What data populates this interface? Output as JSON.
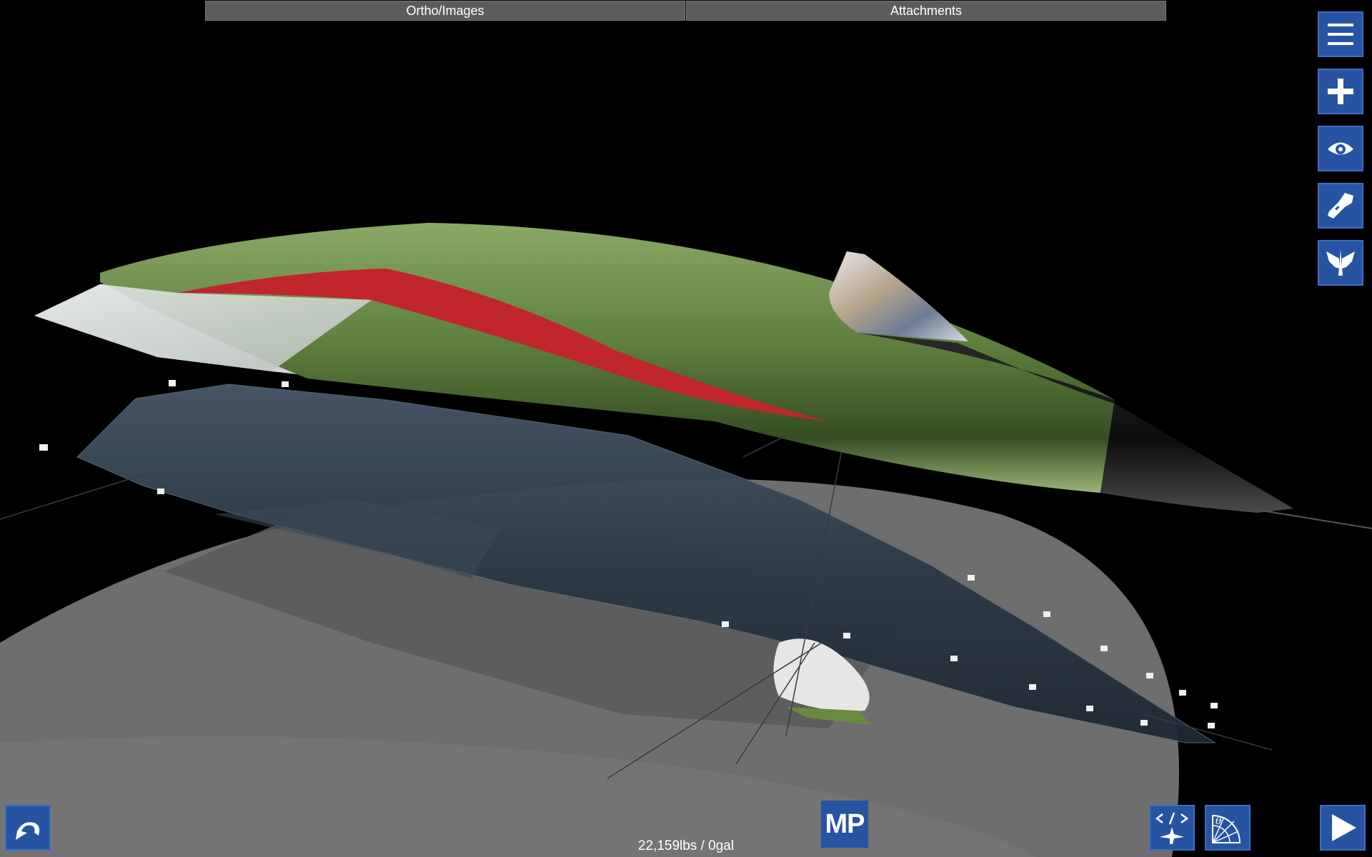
{
  "top_tabs": {
    "ortho_images": "Ortho/Images",
    "attachments": "Attachments"
  },
  "side_toolbar": {
    "icons": [
      "menu-icon",
      "plus-icon",
      "eye-icon",
      "paint-brush-icon",
      "wings-icon"
    ]
  },
  "bottom_bar": {
    "mp_label": "MP",
    "mass_readout": "22,159lbs / 0gal",
    "icons": [
      "undo-icon",
      "code-airplane-icon",
      "angle-gauge-icon",
      "play-icon"
    ]
  },
  "colors": {
    "button_blue": "#2753a3",
    "tab_gray": "#5c5c5c",
    "fuselage_green": "#6f8f4e",
    "stripe_red": "#c0262b",
    "ground_gray": "#6b6b6b"
  }
}
